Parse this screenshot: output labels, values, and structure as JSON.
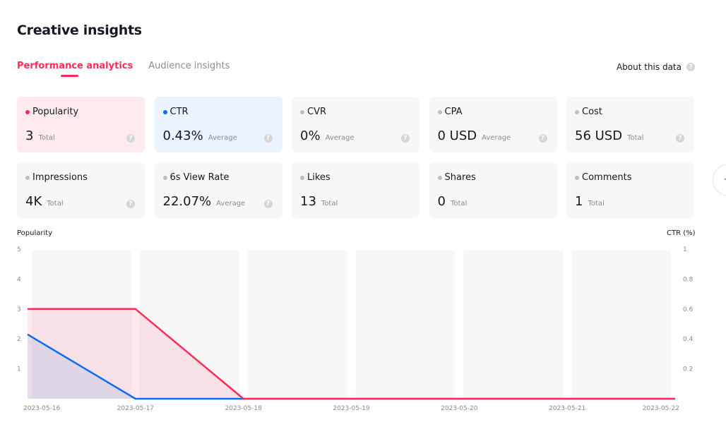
{
  "header": {
    "title": "Creative insights"
  },
  "tabs": [
    {
      "label": "Performance analytics",
      "active": true
    },
    {
      "label": "Audience insights",
      "active": false
    }
  ],
  "about": {
    "label": "About this data",
    "icon": "question-circle-icon"
  },
  "metrics": [
    {
      "label": "Popularity",
      "value": "3",
      "unit": "Total",
      "dot_color": "#fe2c55",
      "selected": "pink",
      "help": true
    },
    {
      "label": "CTR",
      "value": "0.43%",
      "unit": "Average",
      "dot_color": "#0a6cf5",
      "selected": "blue",
      "help": true
    },
    {
      "label": "CVR",
      "value": "0%",
      "unit": "Average",
      "dot_color": "#bdbdbd",
      "selected": "",
      "help": true
    },
    {
      "label": "CPA",
      "value": "0 USD",
      "unit": "Average",
      "dot_color": "#bdbdbd",
      "selected": "",
      "help": true
    },
    {
      "label": "Cost",
      "value": "56 USD",
      "unit": "Total",
      "dot_color": "#bdbdbd",
      "selected": "",
      "help": true
    },
    {
      "label": "Impressions",
      "value": "4K",
      "unit": "Total",
      "dot_color": "#bdbdbd",
      "selected": "",
      "help": true
    },
    {
      "label": "6s View Rate",
      "value": "22.07%",
      "unit": "Average",
      "dot_color": "#bdbdbd",
      "selected": "",
      "help": true
    },
    {
      "label": "Likes",
      "value": "13",
      "unit": "Total",
      "dot_color": "#bdbdbd",
      "selected": "",
      "help": false
    },
    {
      "label": "Shares",
      "value": "0",
      "unit": "Total",
      "dot_color": "#bdbdbd",
      "selected": "",
      "help": false
    },
    {
      "label": "Comments",
      "value": "1",
      "unit": "Total",
      "dot_color": "#bdbdbd",
      "selected": "",
      "help": false
    }
  ],
  "colors": {
    "popularity": "#fe2c55",
    "ctr": "#0a6cf5",
    "band": "#f7f7f7"
  },
  "chart_data": {
    "type": "area",
    "title": "",
    "x": [
      "2023-05-16",
      "2023-05-17",
      "2023-05-18",
      "2023-05-19",
      "2023-05-20",
      "2023-05-21",
      "2023-05-22"
    ],
    "ylabel_left": "Popularity",
    "ylabel_right": "CTR (%)",
    "ylim_left": [
      0,
      5
    ],
    "ylim_right": [
      0,
      1
    ],
    "yticks_left": [
      "1",
      "2",
      "3",
      "4",
      "5"
    ],
    "yticks_right": [
      "0.2",
      "0.4",
      "0.6",
      "0.8",
      "1"
    ],
    "grid": false,
    "series": [
      {
        "name": "Popularity",
        "axis": "left",
        "color": "#fe2c55",
        "values": [
          3,
          3,
          0,
          0,
          0,
          0,
          0
        ]
      },
      {
        "name": "CTR",
        "axis": "right",
        "color": "#0a6cf5",
        "values": [
          0.43,
          0,
          0,
          0,
          0,
          0,
          0
        ]
      }
    ]
  }
}
